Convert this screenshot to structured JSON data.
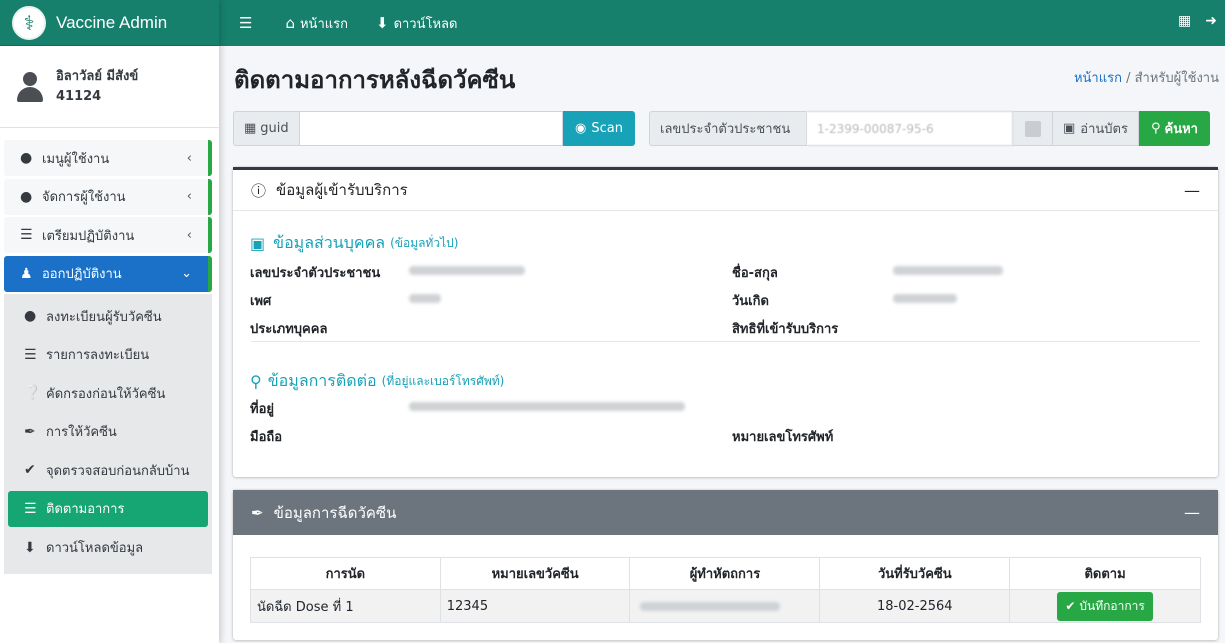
{
  "brand": {
    "title": "Vaccine Admin",
    "logo": "⚕"
  },
  "user": {
    "name": "อิลาวัลย์ มีสังข์",
    "id": "41124"
  },
  "sidebar": {
    "items": [
      {
        "label": "เมนูผู้ใช้งาน",
        "icon": "user-icon"
      },
      {
        "label": "จัดการผู้ใช้งาน",
        "icon": "user-edit-icon"
      },
      {
        "label": "เตรียมปฏิบัติงาน",
        "icon": "list-icon"
      },
      {
        "label": "ออกปฏิบัติงาน",
        "icon": "hospital-user-icon"
      }
    ],
    "subitems": [
      {
        "label": "ลงทะเบียนผู้รับวัคซีน",
        "icon": "user-edit-icon"
      },
      {
        "label": "รายการลงทะเบียน",
        "icon": "list-icon"
      },
      {
        "label": "คัดกรองก่อนให้วัคซีน",
        "icon": "question-circle-icon"
      },
      {
        "label": "การให้วัคซีน",
        "icon": "syringe-icon"
      },
      {
        "label": "จุดตรวจสอบก่อนกลับบ้าน",
        "icon": "check-circle-icon"
      },
      {
        "label": "ติดตามอาการ",
        "icon": "tasks-icon"
      },
      {
        "label": "ดาวน์โหลดข้อมูล",
        "icon": "download-icon"
      }
    ]
  },
  "topbar": {
    "home": "หน้าแรก",
    "download": "ดาวน์โหลด"
  },
  "page": {
    "title": "ติดตามอาการหลังฉีดวัคซีน",
    "breadcrumb_home": "หน้าแรก",
    "breadcrumb_current": "สำหรับผู้ใช้งาน"
  },
  "search": {
    "guid_label": "guid",
    "guid_value": "",
    "scan_label": "Scan",
    "cid_label": "เลขประจำตัวประชาชน",
    "cid_placeholder": "1-2399-00087-95-6",
    "read_card_label": "อ่านบัตร",
    "search_label": "ค้นหา"
  },
  "client_card": {
    "title": "ข้อมูลผู้เข้ารับบริการ",
    "personal_title": "ข้อมูลส่วนบุคคล",
    "personal_sub": "(ข้อมูลทั่วไป)",
    "labels": {
      "cid": "เลขประจำตัวประชาชน",
      "name": "ชื่อ-สกุล",
      "sex": "เพศ",
      "dob": "วันเกิด",
      "type": "ประเภทบุคคล",
      "right": "สิทธิที่เข้ารับบริการ"
    },
    "contact_title": "ข้อมูลการติดต่อ",
    "contact_sub": "(ที่อยู่และเบอร์โทรศัพท์)",
    "contact_labels": {
      "address": "ที่อยู่",
      "mobile": "มือถือ",
      "phone": "หมายเลขโทรศัพท์"
    }
  },
  "vaccine_card": {
    "title": "ข้อมูลการฉีดวัคซีน",
    "columns": [
      "การนัด",
      "หมายเลขวัคซีน",
      "ผู้ทำหัตถการ",
      "วันที่รับวัคซีน",
      "ติดตาม"
    ],
    "rows": [
      {
        "appointment": "นัดฉีด Dose ที่ 1",
        "vaccine_no": "12345",
        "date": "18-02-2564",
        "action": "บันทึกอาการ"
      }
    ]
  },
  "colors": {
    "primary": "#17806d",
    "active_nav": "#1b70c8",
    "current_sub": "#16a673",
    "success": "#28a745",
    "info": "#17a2b8"
  }
}
